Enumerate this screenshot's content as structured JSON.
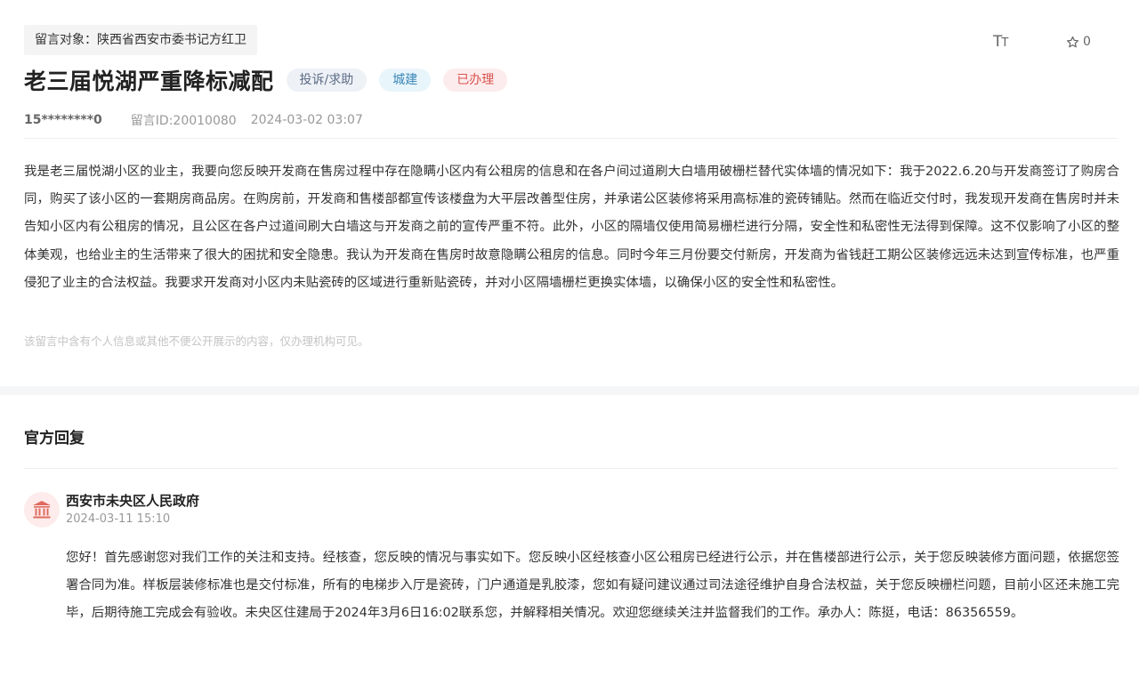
{
  "message": {
    "target_label": "留言对象：陕西省西安市委书记方红卫",
    "title": "老三届悦湖严重降标减配",
    "tags": {
      "type": "投诉/求助",
      "field": "城建",
      "status": "已办理"
    },
    "user": "15********0",
    "message_id": "留言ID:20010080",
    "date": "2024-03-02 03:07",
    "content": "我是老三届悦湖小区的业主，我要向您反映开发商在售房过程中存在隐瞒小区内有公租房的信息和在各户间过道刷大白墙用破栅栏替代实体墙的情况如下：我于2022.6.20与开发商签订了购房合同，购买了该小区的一套期房商品房。在购房前，开发商和售楼部都宣传该楼盘为大平层改善型住房，并承诺公区装修将采用高标准的瓷砖铺贴。然而在临近交付时，我发现开发商在售房时并未告知小区内有公租房的情况，且公区在各户过道间刷大白墙这与开发商之前的宣传严重不符。此外，小区的隔墙仅使用简易栅栏进行分隔，安全性和私密性无法得到保障。这不仅影响了小区的整体美观，也给业主的生活带来了很大的困扰和安全隐患。我认为开发商在售房时故意隐瞒公租房的信息。同时今年三月份要交付新房，开发商为省钱赶工期公区装修远远未达到宣传标准，也严重侵犯了业主的合法权益。我要求开发商对小区内未贴瓷砖的区域进行重新贴瓷砖，并对小区隔墙栅栏更换实体墙，以确保小区的安全性和私密性。",
    "privacy_note": "该留言中含有个人信息或其他不便公开展示的内容，仅办理机构可见。"
  },
  "toolbar": {
    "font_size_icon": "font-size-icon",
    "star_icon": "star-icon",
    "star_count": "0"
  },
  "reply": {
    "heading": "官方回复",
    "avatar_icon": "government-building-icon",
    "org_name": "西安市未央区人民政府",
    "time": "2024-03-11 15:10",
    "content": "您好！首先感谢您对我们工作的关注和支持。经核查，您反映的情况与事实如下。您反映小区经核查小区公租房已经进行公示，并在售楼部进行公示，关于您反映装修方面问题，依据您签署合同为准。样板层装修标准也是交付标准，所有的电梯步入厅是瓷砖，门户通道是乳胶漆，您如有疑问建议通过司法途径维护自身合法权益，关于您反映栅栏问题，目前小区还未施工完毕，后期待施工完成会有验收。未央区住建局于2024年3月6日16:02联系您，并解释相关情况。欢迎您继续关注并监督我们的工作。承办人：陈挺，电话：86356559。"
  },
  "colors": {
    "tag_type_bg": "#eef1f6",
    "tag_field_bg": "#e8f5fb",
    "tag_status_bg": "#fdeced",
    "status_red": "#d9534f",
    "section_band": "#f4f6f8"
  }
}
